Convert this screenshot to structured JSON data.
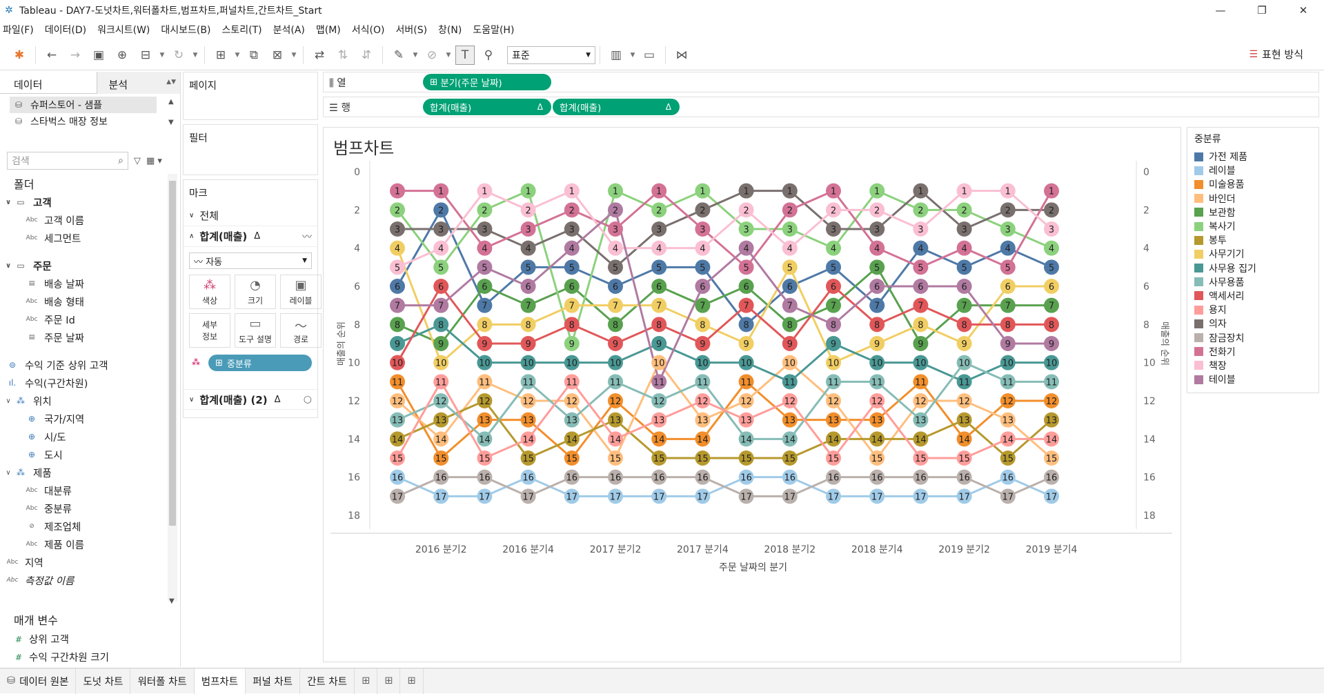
{
  "window": {
    "title": "Tableau - DAY7-도넛차트,워터폴차트,범프차트,퍼널차트,간트차트_Start"
  },
  "menu": [
    "파일(F)",
    "데이터(D)",
    "워크시트(W)",
    "대시보드(B)",
    "스토리(T)",
    "분석(A)",
    "맵(M)",
    "서식(O)",
    "서버(S)",
    "창(N)",
    "도움말(H)"
  ],
  "toolbar": {
    "fit_value": "표준",
    "present_label": "표현 방식"
  },
  "left_panel": {
    "tab_data": "데이터",
    "tab_analysis": "분석",
    "datasources": [
      "슈퍼스토어 - 샘플",
      "스타벅스 매장 정보"
    ],
    "search_placeholder": "검색",
    "folder_header": "폴더",
    "fields": [
      {
        "type": "group",
        "label": "고객",
        "indent": 0
      },
      {
        "type": "Abc",
        "label": "고객 이름",
        "indent": 1
      },
      {
        "type": "Abc",
        "label": "세그먼트",
        "indent": 1
      },
      {
        "type": "spacer"
      },
      {
        "type": "group",
        "label": "주문",
        "indent": 0
      },
      {
        "type": "date",
        "label": "배송 날짜",
        "indent": 1
      },
      {
        "type": "Abc",
        "label": "배송 형태",
        "indent": 1
      },
      {
        "type": "Abc",
        "label": "주문 Id",
        "indent": 1
      },
      {
        "type": "date",
        "label": "주문 날짜",
        "indent": 1
      },
      {
        "type": "spacer"
      },
      {
        "type": "set",
        "label": "수익 기준 상위 고객",
        "indent": 0
      },
      {
        "type": "bin",
        "label": "수익(구간차원)",
        "indent": 0
      },
      {
        "type": "hier",
        "label": "위치",
        "indent": 0
      },
      {
        "type": "geo",
        "label": "국가/지역",
        "indent": 1
      },
      {
        "type": "geo",
        "label": "시/도",
        "indent": 1
      },
      {
        "type": "geo",
        "label": "도시",
        "indent": 1
      },
      {
        "type": "hier",
        "label": "제품",
        "indent": 0
      },
      {
        "type": "Abc",
        "label": "대분류",
        "indent": 1
      },
      {
        "type": "Abc",
        "label": "중분류",
        "indent": 1
      },
      {
        "type": "clip",
        "label": "제조업체",
        "indent": 1
      },
      {
        "type": "Abc",
        "label": "제품 이름",
        "indent": 1
      },
      {
        "type": "Abc",
        "label": "지역",
        "indent": 0
      },
      {
        "type": "Abc",
        "label": "측정값 이름",
        "indent": 0,
        "italic": true
      }
    ],
    "param_header": "매개 변수",
    "params": [
      "상위 고객",
      "수익 구간차원 크기"
    ]
  },
  "mid_panel": {
    "pages": "페이지",
    "filters": "필터",
    "marks": "마크",
    "all": "전체",
    "sum_sales": "합계(매출)",
    "sum_sales2": "합계(매출) (2)",
    "mark_type": "자동",
    "buttons": [
      "색상",
      "크기",
      "레이블",
      "세부 정보",
      "도구 설명",
      "경로"
    ],
    "color_pill": "중분류"
  },
  "shelves": {
    "columns_label": "열",
    "rows_label": "행",
    "columns_pill": "분기(주문 날짜)",
    "rows_pills": [
      "합계(매출)",
      "합계(매출)"
    ]
  },
  "viz": {
    "title": "범프차트"
  },
  "chart_data": {
    "type": "line",
    "title": "범프차트",
    "xlabel": "주문 날짜의 분기",
    "ylabel": "매출의 순위",
    "y_axis_reversed": true,
    "ylim": [
      0,
      18
    ],
    "y_ticks": [
      0,
      2,
      4,
      6,
      8,
      10,
      12,
      14,
      16,
      18
    ],
    "x_tick_labels": [
      "2016 분기2",
      "2016 분기4",
      "2017 분기2",
      "2017 분기4",
      "2018 분기2",
      "2018 분기4",
      "2019 분기2",
      "2019 분기4"
    ],
    "x": [
      "2016 분기1",
      "2016 분기2",
      "2016 분기3",
      "2016 분기4",
      "2017 분기1",
      "2017 분기2",
      "2017 분기3",
      "2017 분기4",
      "2018 분기1",
      "2018 분기2",
      "2018 분기3",
      "2018 분기4",
      "2019 분기1",
      "2019 분기2",
      "2019 분기3",
      "2019 분기4"
    ],
    "legend_title": "중분류",
    "series": [
      {
        "name": "가전 제품",
        "color": "#4e79a7",
        "values": [
          6,
          2,
          7,
          5,
          5,
          6,
          5,
          5,
          8,
          6,
          5,
          7,
          4,
          5,
          4,
          5
        ]
      },
      {
        "name": "레이블",
        "color": "#a0cbe8",
        "values": [
          16,
          17,
          17,
          16,
          17,
          17,
          17,
          17,
          16,
          16,
          17,
          17,
          17,
          17,
          16,
          17
        ]
      },
      {
        "name": "미술용품",
        "color": "#f28e2b",
        "values": [
          11,
          15,
          13,
          13,
          15,
          12,
          14,
          14,
          11,
          13,
          13,
          13,
          11,
          14,
          12,
          12
        ]
      },
      {
        "name": "바인더",
        "color": "#ffbe7d",
        "values": [
          12,
          14,
          11,
          12,
          12,
          15,
          10,
          13,
          12,
          10,
          12,
          15,
          12,
          12,
          13,
          15
        ]
      },
      {
        "name": "보관함",
        "color": "#59a14f",
        "values": [
          8,
          9,
          6,
          7,
          6,
          8,
          6,
          7,
          6,
          8,
          7,
          5,
          9,
          7,
          7,
          7
        ]
      },
      {
        "name": "복사기",
        "color": "#8cd17d",
        "values": [
          2,
          5,
          2,
          1,
          9,
          1,
          2,
          1,
          3,
          3,
          4,
          1,
          2,
          2,
          3,
          4
        ]
      },
      {
        "name": "봉투",
        "color": "#b6992d",
        "values": [
          14,
          13,
          12,
          15,
          14,
          13,
          15,
          15,
          15,
          15,
          14,
          14,
          14,
          13,
          15,
          13
        ]
      },
      {
        "name": "사무기기",
        "color": "#f1ce63",
        "values": [
          4,
          10,
          8,
          8,
          7,
          7,
          7,
          8,
          9,
          5,
          10,
          9,
          8,
          9,
          6,
          6
        ]
      },
      {
        "name": "사무용 집기",
        "color": "#499894",
        "values": [
          9,
          8,
          10,
          10,
          10,
          10,
          9,
          10,
          10,
          11,
          9,
          10,
          10,
          11,
          10,
          10
        ]
      },
      {
        "name": "사무용품",
        "color": "#86bcb6",
        "values": [
          13,
          12,
          14,
          11,
          13,
          11,
          12,
          11,
          14,
          14,
          11,
          11,
          13,
          10,
          11,
          11
        ]
      },
      {
        "name": "액세서리",
        "color": "#e15759",
        "values": [
          10,
          6,
          9,
          9,
          8,
          9,
          8,
          9,
          7,
          9,
          6,
          8,
          7,
          8,
          8,
          8
        ]
      },
      {
        "name": "용지",
        "color": "#ff9d9a",
        "values": [
          15,
          11,
          15,
          14,
          11,
          14,
          13,
          12,
          13,
          12,
          15,
          12,
          15,
          15,
          14,
          14
        ]
      },
      {
        "name": "의자",
        "color": "#79706e",
        "values": [
          3,
          3,
          3,
          4,
          3,
          5,
          3,
          2,
          1,
          1,
          3,
          3,
          1,
          3,
          2,
          2
        ]
      },
      {
        "name": "잠금장치",
        "color": "#bab0ac",
        "values": [
          17,
          16,
          16,
          17,
          16,
          16,
          16,
          16,
          17,
          17,
          16,
          16,
          16,
          16,
          17,
          16
        ]
      },
      {
        "name": "전화기",
        "color": "#d37295",
        "values": [
          1,
          1,
          4,
          3,
          2,
          3,
          1,
          3,
          5,
          2,
          1,
          4,
          5,
          4,
          5,
          1
        ]
      },
      {
        "name": "책장",
        "color": "#fabfd2",
        "values": [
          5,
          4,
          1,
          2,
          1,
          4,
          4,
          4,
          2,
          4,
          2,
          2,
          3,
          1,
          1,
          3
        ]
      },
      {
        "name": "테이블",
        "color": "#b07aa1",
        "values": [
          7,
          7,
          5,
          6,
          4,
          2,
          11,
          6,
          4,
          7,
          8,
          6,
          6,
          6,
          9,
          9
        ]
      }
    ]
  },
  "bottom_tabs": [
    "데이터 원본",
    "도넛 차트",
    "워터폴 차트",
    "범프차트",
    "퍼널 차트",
    "간트 차트"
  ],
  "active_tab": "범프차트"
}
